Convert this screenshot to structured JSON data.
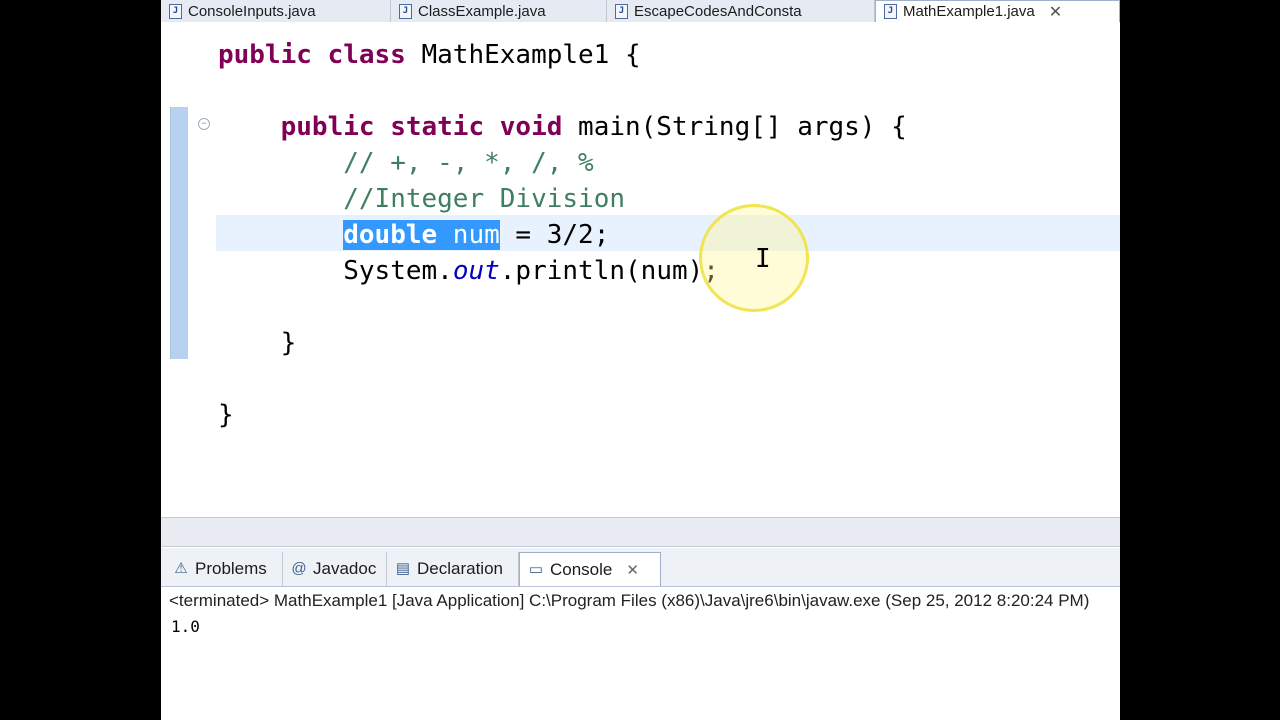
{
  "editor_tabs": [
    {
      "label": "ConsoleInputs.java",
      "active": false
    },
    {
      "label": "ClassExample.java",
      "active": false
    },
    {
      "label": "EscapeCodesAndConsta",
      "active": false
    },
    {
      "label": "MathExample1.java",
      "active": true
    }
  ],
  "tab_close_glyph": "✕",
  "code": {
    "line1": {
      "kw": "public class",
      "rest": " MathExample1 {"
    },
    "line3": {
      "indent": "    ",
      "kw": "public static void",
      "rest": " main(String[] args) {"
    },
    "line4": {
      "indent": "        ",
      "comment": "// +, -, *, /, %"
    },
    "line5": {
      "indent": "        ",
      "comment": "//Integer Division"
    },
    "line6": {
      "indent": "        ",
      "sel_kw": "double",
      "sel_rest": " num",
      "rest": " = 3/2;"
    },
    "line7": {
      "indent": "        ",
      "pre": "System.",
      "field": "out",
      "post": ".println(num);"
    },
    "line9": {
      "indent": "    ",
      "text": "}"
    },
    "line11": {
      "text": "}"
    }
  },
  "view_tabs": [
    {
      "label": "Problems",
      "icon": "problems-icon",
      "glyph": "⚠"
    },
    {
      "label": "Javadoc",
      "icon": "javadoc-icon",
      "glyph": "@"
    },
    {
      "label": "Declaration",
      "icon": "declaration-icon",
      "glyph": "▤"
    },
    {
      "label": "Console",
      "icon": "console-icon",
      "glyph": "▭",
      "active": true
    }
  ],
  "view_close_glyph": "✕",
  "console": {
    "header": "<terminated> MathExample1 [Java Application] C:\\Program Files (x86)\\Java\\jre6\\bin\\javaw.exe (Sep 25, 2012 8:20:24 PM)",
    "output": "1.0"
  },
  "colors": {
    "keyword": "#7f0055",
    "comment": "#3f7f5f",
    "field": "#0000c0",
    "selection": "#3399ff"
  }
}
